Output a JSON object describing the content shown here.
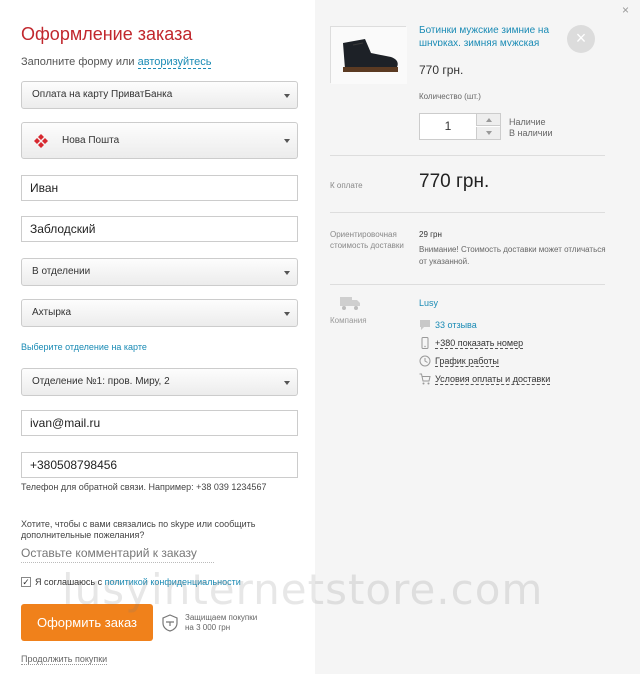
{
  "form": {
    "title": "Оформление заказа",
    "subtitle_prefix": "Заполните форму или",
    "login_link": "авторизуйтесь",
    "payment_select": "Оплата на карту ПриватБанка",
    "delivery_select": "Нова Пошта",
    "first_name": "Иван",
    "last_name": "Заблодский",
    "delivery_type_select": "В отделении",
    "city_select": "Ахтырка",
    "map_link": "Выберите отделение на карте",
    "office_select": "Отделение №1: пров. Миру, 2",
    "email": "ivan@mail.ru",
    "phone": "+380508798456",
    "phone_hint": "Телефон для обратной связи. Например: +38 039 1234567",
    "skype_question": "Хотите, чтобы с вами связались по skype или сообщить дополнительные пожелания?",
    "comment_placeholder": "Оставьте комментарий к заказу",
    "agree_prefix": "Я соглашаюсь с",
    "agree_link": "политикой конфиденциальности",
    "agree_checked": "✓",
    "order_button": "Оформить заказ",
    "protect_text_line1": "Защищаем покупки",
    "protect_text_line2": "на 3 000 грн",
    "continue_link": "Продолжить покупки"
  },
  "cart": {
    "close_glyph": "×",
    "remove_glyph": "×",
    "product_name": "Ботинки мужские зимние на шнурках, зимняя мужская",
    "price": "770 грн.",
    "qty_label": "Количество (шт.)",
    "qty_value": "1",
    "avail_line1": "Наличие",
    "avail_line2": "В наличии",
    "to_pay_label": "К оплате",
    "total": "770 грн.",
    "shipping_label": "Ориентировочная стоимость доставки",
    "shipping_price": "29 грн",
    "shipping_note": "Внимание! Стоимость доставки может отличаться от указанной.",
    "company_label": "Компания",
    "seller": "Lusy",
    "reviews": "33 отзыва",
    "phone_link": "+380 показать номер",
    "schedule": "График работы",
    "terms": "Условия оплаты и доставки"
  },
  "watermark": "lusyinternetstore.com",
  "colors": {
    "title": "#c1272d",
    "link": "#1a8bb5",
    "button": "#f0811b"
  }
}
